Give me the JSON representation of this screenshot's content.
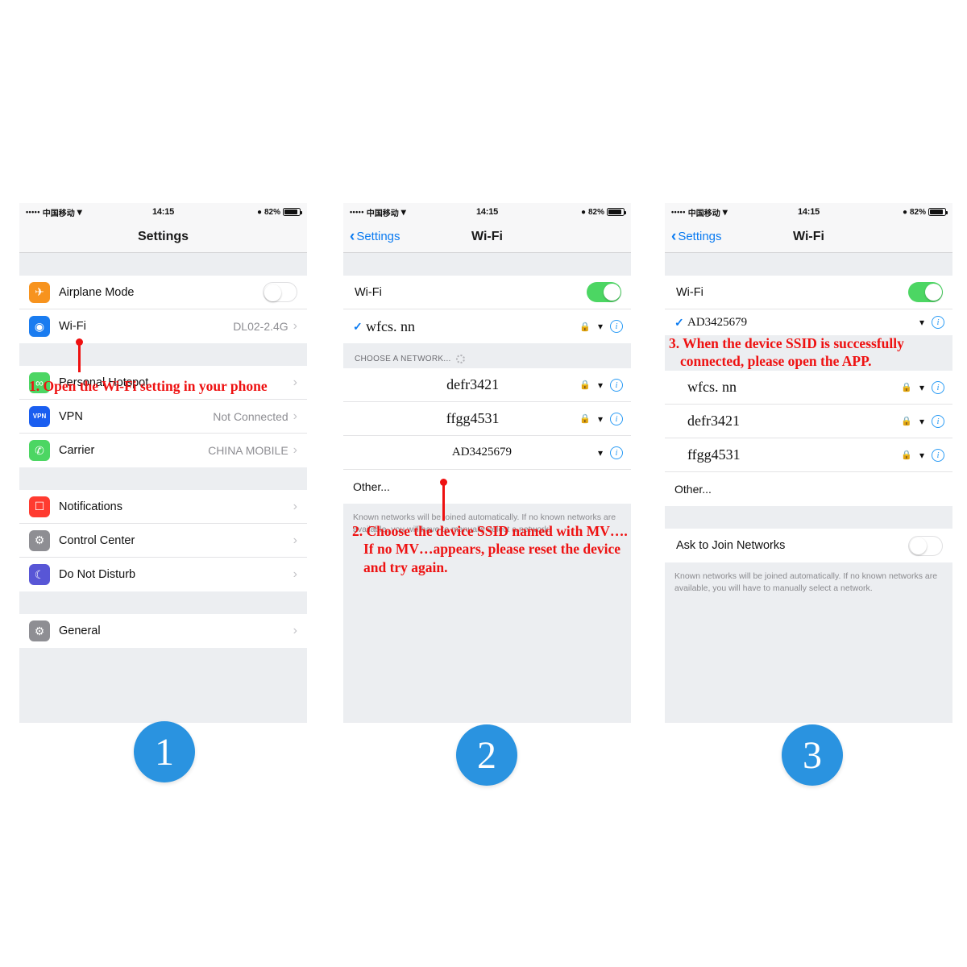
{
  "status_bar": {
    "signal_dots": "•••••",
    "carrier": "中国移动",
    "wifi_icon": "wifi-icon",
    "time": "14:15",
    "alarm_icon": "alarm-icon",
    "battery_pct": "82%"
  },
  "panel1": {
    "nav_title": "Settings",
    "rows_group1": [
      {
        "icon": "airplane-icon",
        "icon_color": "#f7931e",
        "label": "Airplane Mode",
        "control": "toggle-off"
      },
      {
        "icon": "wifi-icon",
        "icon_color": "#1a7cf0",
        "label": "Wi-Fi",
        "value": "DL02-2.4G",
        "control": "chevron"
      }
    ],
    "rows_group2": [
      {
        "icon": "hotspot-icon",
        "icon_color": "#4cd663",
        "label": "Personal Hotspot",
        "value": "",
        "control": "chevron"
      },
      {
        "icon": "vpn-icon",
        "icon_color": "#1a5ef0",
        "label": "VPN",
        "value": "Not Connected",
        "control": "chevron"
      },
      {
        "icon": "phone-icon",
        "icon_color": "#4cd663",
        "label": "Carrier",
        "value": "CHINA MOBILE",
        "control": "chevron"
      }
    ],
    "rows_group3": [
      {
        "icon": "notifications-icon",
        "icon_color": "#ff3b30",
        "label": "Notifications",
        "value": "",
        "control": "chevron"
      },
      {
        "icon": "control-center-icon",
        "icon_color": "#8e8e93",
        "label": "Control Center",
        "value": "",
        "control": "chevron"
      },
      {
        "icon": "moon-icon",
        "icon_color": "#5856d6",
        "label": "Do Not Disturb",
        "value": "",
        "control": "chevron"
      }
    ],
    "rows_group4": [
      {
        "icon": "gear-icon",
        "icon_color": "#8e8e93",
        "label": "General",
        "value": "",
        "control": "chevron"
      }
    ],
    "annotation": "1. Open the Wi-Fi setting in your phone"
  },
  "panel2": {
    "nav_back": "Settings",
    "nav_title": "Wi-Fi",
    "wifi_label": "Wi-Fi",
    "wifi_toggle": "on",
    "connected": {
      "ssid": "wfcs. nn",
      "locked": true,
      "signal": "wifi-icon",
      "checked": true
    },
    "section_header": "CHOOSE A NETWORK...",
    "networks": [
      {
        "ssid": "defr3421",
        "locked": true
      },
      {
        "ssid": "ffgg4531",
        "locked": true
      },
      {
        "ssid": "AD3425679",
        "locked": false
      }
    ],
    "other_label": "Other...",
    "footnote": "Known networks will be joined automatically. If no known networks are available, you will have to manually select a network.",
    "annotation": "2. Choose the device SSID named with MV…. If no MV…appears, please reset the device and try again."
  },
  "panel3": {
    "nav_back": "Settings",
    "nav_title": "Wi-Fi",
    "wifi_label": "Wi-Fi",
    "wifi_toggle": "on",
    "connected": {
      "ssid": "AD3425679",
      "locked": false,
      "signal": "wifi-icon",
      "checked": true
    },
    "networks": [
      {
        "ssid": "wfcs. nn",
        "locked": true
      },
      {
        "ssid": "defr3421",
        "locked": true
      },
      {
        "ssid": "ffgg4531",
        "locked": true
      }
    ],
    "other_label": "Other...",
    "ask_to_join_label": "Ask to Join Networks",
    "ask_to_join_toggle": "off",
    "footnote": "Known networks will be joined automatically. If no known networks are available, you will have to manually select a network.",
    "annotation": "3. When the device SSID is successfully connected, please open the APP."
  },
  "step_circles": [
    {
      "number": "1"
    },
    {
      "number": "2"
    },
    {
      "number": "3"
    }
  ],
  "colors": {
    "accent_blue": "#2a93e0",
    "annotation_red": "#ee1111",
    "toggle_green": "#4cd663",
    "ios_link_blue": "#0b7bf1"
  }
}
